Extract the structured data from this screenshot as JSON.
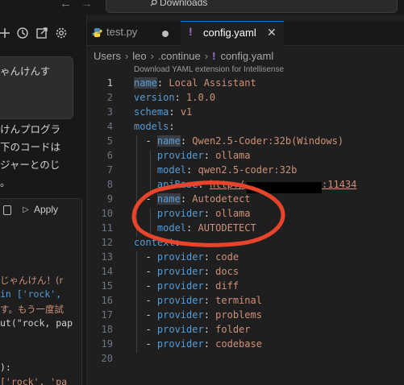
{
  "titlebar": {
    "search_label": "Downloads",
    "back_icon": "arrow-left-icon",
    "forward_icon": "arrow-right-icon"
  },
  "left_panel": {
    "toolbar_icons": [
      "plus-icon",
      "history-icon",
      "open-external-icon",
      "gear-icon"
    ],
    "chat_bubble_text": "ゃんけんす",
    "response_lines": [
      "けんプログラ",
      "下のコードは",
      "ジャーとのじ",
      "。"
    ],
    "code_block": {
      "apply_label": "Apply",
      "lines": [
        {
          "text": "じゃんけん！(r",
          "color": "#ce9178"
        },
        {
          "text": " in ['rock',",
          "color": "#569cd6"
        },
        {
          "text": "す。もう一度試",
          "color": "#ce9178"
        },
        {
          "text": "ut(\"rock, pap",
          "color": "#d4d4d4"
        },
        {
          "text": "):",
          "color": "#d4d4d4"
        },
        {
          "text": "['rock', 'pa",
          "color": "#ce9178"
        }
      ]
    }
  },
  "tabs": [
    {
      "label": "test.py",
      "icon": "python-icon",
      "modified": true
    },
    {
      "label": "config.yaml",
      "icon": "yaml-exclamation-icon",
      "active": true
    }
  ],
  "breadcrumb": {
    "items": [
      "Users",
      "leo",
      ".continue",
      "config.yaml"
    ]
  },
  "editor": {
    "codelens": "Download YAML extension for Intellisense",
    "line_numbers": [
      "1",
      "2",
      "3",
      "4",
      "5",
      "6",
      "7",
      "8",
      "9",
      "10",
      "11",
      "12",
      "13",
      "14",
      "15",
      "16",
      "17",
      "18",
      "19",
      "20"
    ],
    "lines": {
      "l1": {
        "key": "name",
        "val": "Local Assistant"
      },
      "l2": {
        "key": "version",
        "val": "1.0.0"
      },
      "l3": {
        "key": "schema",
        "val": "v1"
      },
      "l4": {
        "key": "models"
      },
      "l5": {
        "key": "name",
        "val": "Qwen2.5-Coder:32b(Windows)"
      },
      "l6": {
        "key": "provider",
        "val": "ollama"
      },
      "l7": {
        "key": "model",
        "val": "qwen2.5-coder:32b"
      },
      "l8": {
        "key": "apiBase",
        "val_start": "http:/",
        "val_end": ":11434"
      },
      "l9": {
        "key": "name",
        "val": "Autodetect"
      },
      "l10": {
        "key": "provider",
        "val": "ollama"
      },
      "l11": {
        "key": "model",
        "val": "AUTODETECT"
      },
      "l12": {
        "key": "context"
      },
      "l13": {
        "key": "provider",
        "val": "code"
      },
      "l14": {
        "key": "provider",
        "val": "docs"
      },
      "l15": {
        "key": "provider",
        "val": "diff"
      },
      "l16": {
        "key": "provider",
        "val": "terminal"
      },
      "l17": {
        "key": "provider",
        "val": "problems"
      },
      "l18": {
        "key": "provider",
        "val": "folder"
      },
      "l19": {
        "key": "provider",
        "val": "codebase"
      }
    }
  },
  "colors": {
    "key": "#569cd6",
    "string": "#ce9178",
    "annotation": "#e8442b",
    "active_tab_border": "#0078d4"
  }
}
